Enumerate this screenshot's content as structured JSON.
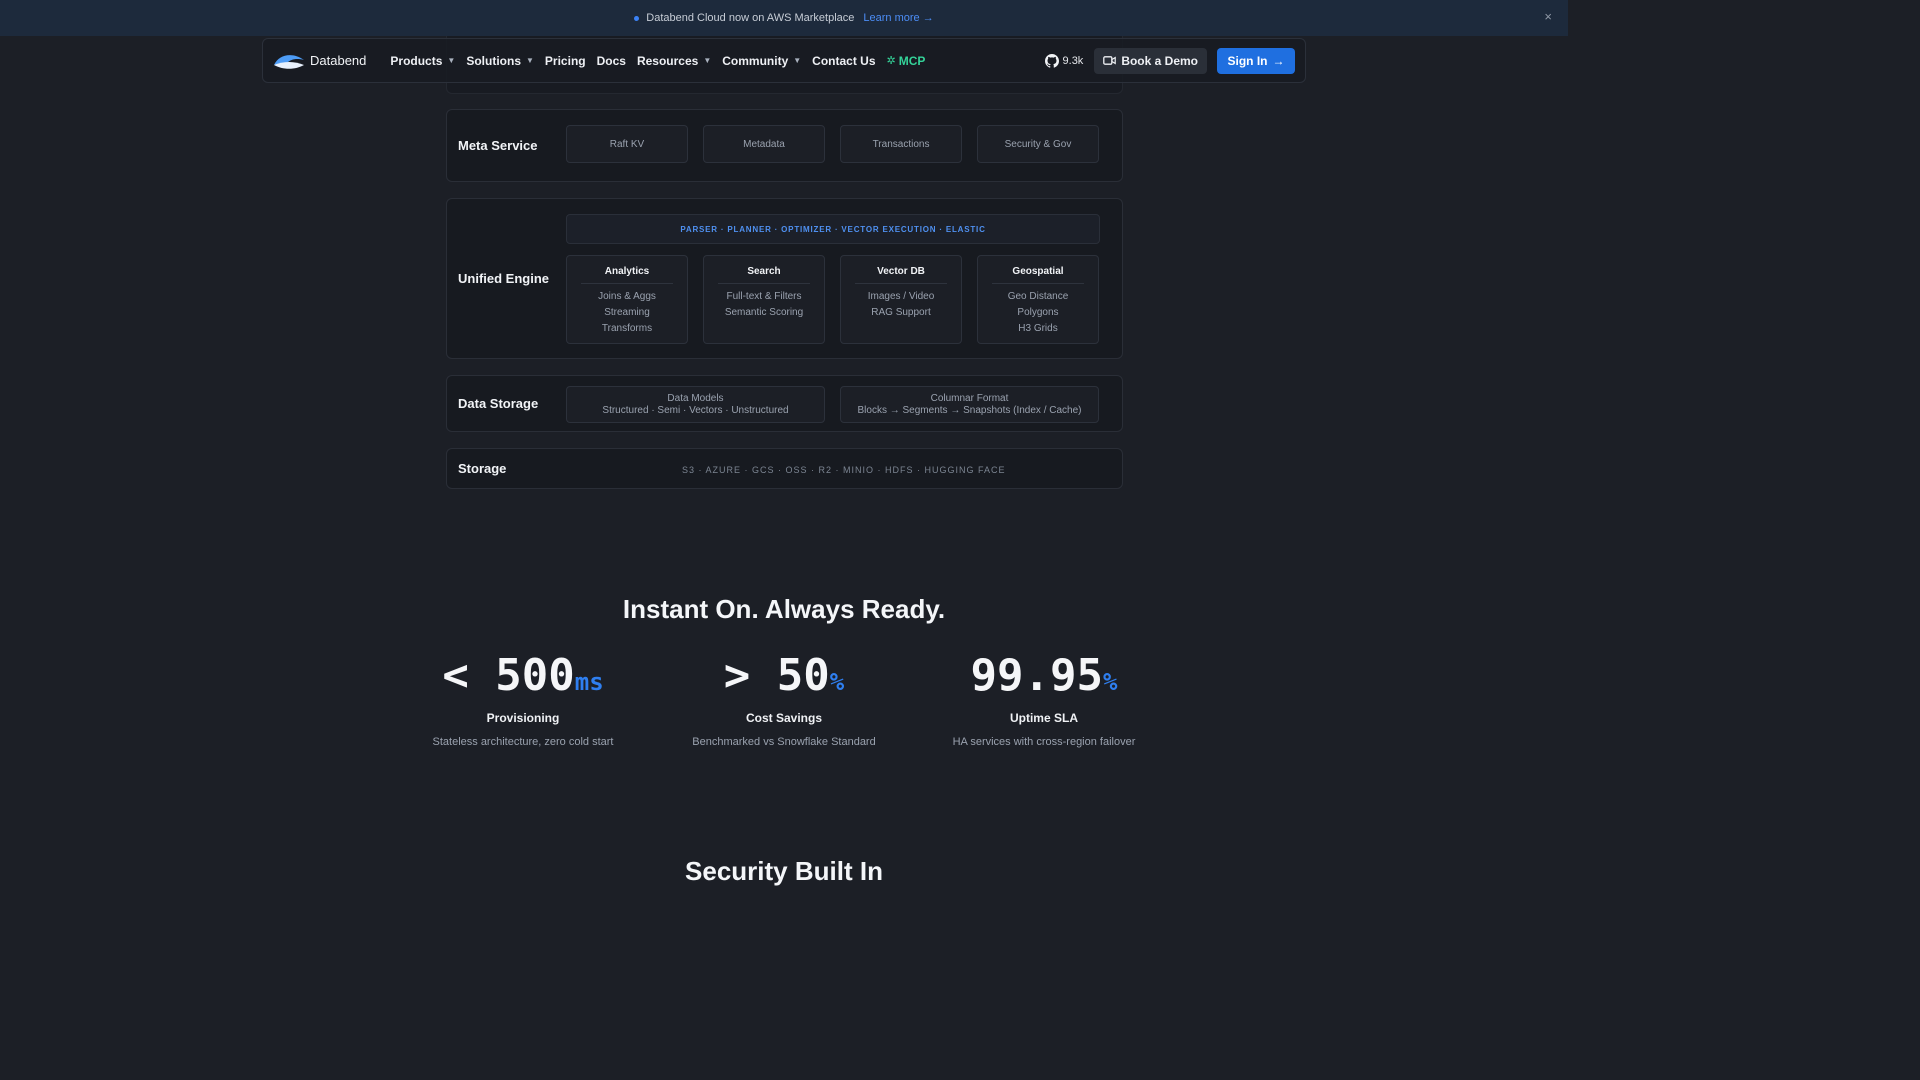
{
  "banner": {
    "text": "Databend Cloud now on AWS Marketplace",
    "link": "Learn more →",
    "close": "×"
  },
  "nav": {
    "brand": "Databend",
    "items": [
      {
        "label": "Products",
        "dropdown": true
      },
      {
        "label": "Solutions",
        "dropdown": true
      },
      {
        "label": "Pricing",
        "dropdown": false
      },
      {
        "label": "Docs",
        "dropdown": false
      },
      {
        "label": "Resources",
        "dropdown": true
      },
      {
        "label": "Community",
        "dropdown": true
      },
      {
        "label": "Contact Us",
        "dropdown": false
      }
    ],
    "mcp": "MCP",
    "github_stars": "9.3k",
    "demo": "Book a Demo",
    "signin": "Sign In",
    "icons": {
      "github": "github-icon",
      "video": "video-camera-icon",
      "mcp": "sparkle-icon"
    }
  },
  "architecture": {
    "meta": {
      "title": "Meta Service",
      "cells": [
        "Raft KV",
        "Metadata",
        "Transactions",
        "Security & Gov"
      ]
    },
    "engine": {
      "title": "Unified Engine",
      "pipeline": "PARSER · PLANNER · OPTIMIZER · VECTOR EXECUTION · ELASTIC",
      "cards": [
        {
          "title": "Analytics",
          "lines": [
            "Joins & Aggs",
            "Streaming",
            "Transforms"
          ]
        },
        {
          "title": "Search",
          "lines": [
            "Full-text & Filters",
            "Semantic Scoring"
          ]
        },
        {
          "title": "Vector DB",
          "lines": [
            "Images / Video",
            "RAG Support"
          ]
        },
        {
          "title": "Geospatial",
          "lines": [
            "Geo Distance",
            "Polygons",
            "H3 Grids"
          ]
        }
      ]
    },
    "data_storage": {
      "title": "Data Storage",
      "cells": [
        {
          "title": "Data Models",
          "sub": "Structured · Semi · Vectors · Unstructured"
        },
        {
          "title": "Columnar Format",
          "sub": "Blocks → Segments → Snapshots (Index / Cache)"
        }
      ]
    },
    "storage": {
      "title": "Storage",
      "providers": "S3 · AZURE · GCS · OSS · R2 · MINIO · HDFS · HUGGING FACE"
    }
  },
  "stats_section": {
    "title": "Instant On. Always Ready.",
    "stats": [
      {
        "value": "< 500",
        "unit": "ms",
        "label": "Provisioning",
        "desc": "Stateless architecture, zero cold start"
      },
      {
        "value": "> 50",
        "unit": "%",
        "label": "Cost Savings",
        "desc": "Benchmarked vs Snowflake Standard"
      },
      {
        "value": "99.95",
        "unit": "%",
        "label": "Uptime SLA",
        "desc": "HA services with cross-region failover"
      }
    ]
  },
  "next_section": {
    "title": "Security Built In"
  },
  "colors": {
    "accent": "#1f6fe0",
    "mcp": "#34d399",
    "background": "#1c1f26"
  }
}
